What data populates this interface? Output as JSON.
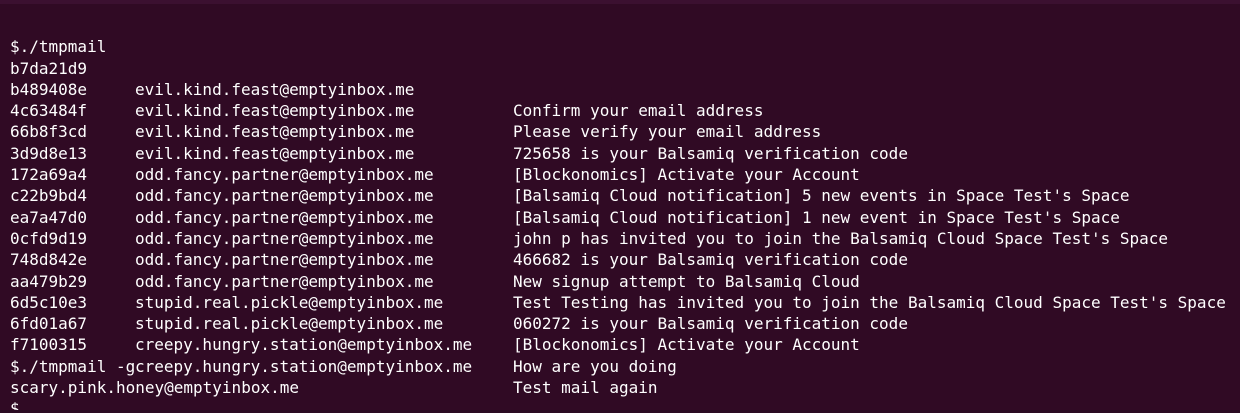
{
  "terminal": {
    "command_1": "$./tmpmail",
    "emails": [
      {
        "id": "b7da21d9",
        "address": "evil.kind.feast@emptyinbox.me",
        "subject": "Confirm your email address"
      },
      {
        "id": "b489408e",
        "address": "evil.kind.feast@emptyinbox.me",
        "subject": "Please verify your email address"
      },
      {
        "id": "4c63484f",
        "address": "evil.kind.feast@emptyinbox.me",
        "subject": "725658 is your Balsamiq verification code"
      },
      {
        "id": "66b8f3cd",
        "address": "evil.kind.feast@emptyinbox.me",
        "subject": "[Blockonomics] Activate your Account"
      },
      {
        "id": "3d9d8e13",
        "address": "odd.fancy.partner@emptyinbox.me",
        "subject": "[Balsamiq Cloud notification] 5 new events in Space Test's Space"
      },
      {
        "id": "172a69a4",
        "address": "odd.fancy.partner@emptyinbox.me",
        "subject": "[Balsamiq Cloud notification] 1 new event in Space Test's Space"
      },
      {
        "id": "c22b9bd4",
        "address": "odd.fancy.partner@emptyinbox.me",
        "subject": "john p has invited you to join the Balsamiq Cloud Space Test's Space"
      },
      {
        "id": "ea7a47d0",
        "address": "odd.fancy.partner@emptyinbox.me",
        "subject": "466682 is your Balsamiq verification code"
      },
      {
        "id": "0cfd9d19",
        "address": "odd.fancy.partner@emptyinbox.me",
        "subject": "New signup attempt to Balsamiq Cloud"
      },
      {
        "id": "748d842e",
        "address": "odd.fancy.partner@emptyinbox.me",
        "subject": "Test Testing has invited you to join the Balsamiq Cloud Space Test's Space"
      },
      {
        "id": "aa479b29",
        "address": "stupid.real.pickle@emptyinbox.me",
        "subject": "060272 is your Balsamiq verification code"
      },
      {
        "id": "6d5c10e3",
        "address": "stupid.real.pickle@emptyinbox.me",
        "subject": "[Blockonomics] Activate your Account"
      },
      {
        "id": "6fd01a67",
        "address": "creepy.hungry.station@emptyinbox.me",
        "subject": "How are you doing"
      },
      {
        "id": "f7100315",
        "address": "creepy.hungry.station@emptyinbox.me",
        "subject": "Test mail again"
      }
    ],
    "command_2": "$./tmpmail -g",
    "output_2": "scary.pink.honey@emptyinbox.me",
    "prompt": "$"
  },
  "colors": {
    "background": "#300a24",
    "text": "#ffffff"
  }
}
